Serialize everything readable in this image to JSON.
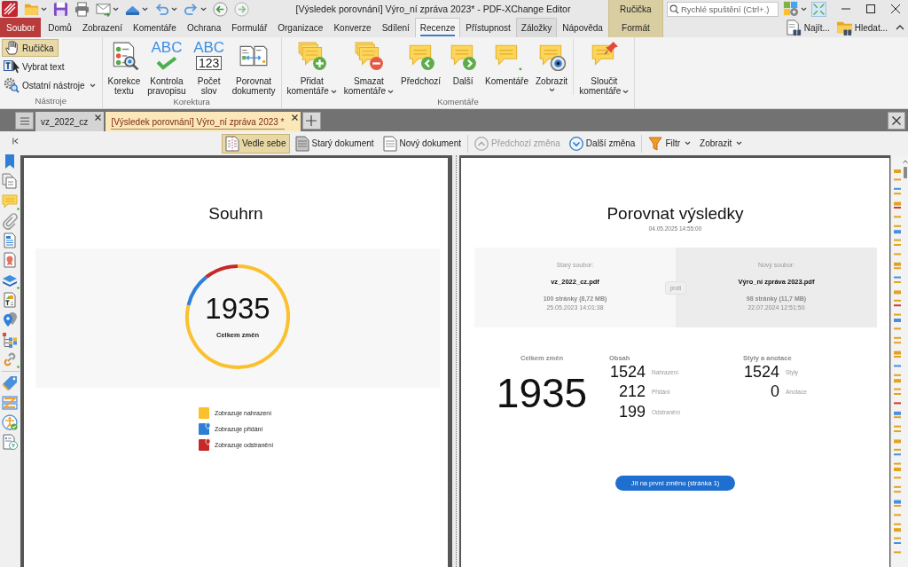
{
  "title_bar": {
    "title": "[Výsledek porovnání] Výro_ní zpráva 2023* - PDF-XChange Editor",
    "context_group": "Ručička",
    "search": {
      "placeholder": "Rychlé spuštění (Ctrl+.)"
    }
  },
  "menu_tabs": [
    {
      "label": "Soubor",
      "kind": "file",
      "selected": false,
      "hovered": false
    },
    {
      "label": "Domů",
      "kind": "tab",
      "selected": false,
      "hovered": false
    },
    {
      "label": "Zobrazení",
      "kind": "tab",
      "selected": false,
      "hovered": false
    },
    {
      "label": "Komentáře",
      "kind": "tab",
      "selected": false,
      "hovered": false
    },
    {
      "label": "Ochrana",
      "kind": "tab",
      "selected": false,
      "hovered": false
    },
    {
      "label": "Formulář",
      "kind": "tab",
      "selected": false,
      "hovered": false
    },
    {
      "label": "Organizace",
      "kind": "tab",
      "selected": false,
      "hovered": false
    },
    {
      "label": "Konverze",
      "kind": "tab",
      "selected": false,
      "hovered": false
    },
    {
      "label": "Sdílení",
      "kind": "tab",
      "selected": false,
      "hovered": false
    },
    {
      "label": "Recenze",
      "kind": "tab",
      "selected": true,
      "hovered": false
    },
    {
      "label": "Přístupnost",
      "kind": "tab",
      "selected": false,
      "hovered": false
    },
    {
      "label": "Záložky",
      "kind": "tab",
      "selected": false,
      "hovered": true
    },
    {
      "label": "Nápověda",
      "kind": "tab",
      "selected": false,
      "hovered": false
    }
  ],
  "context_tab": {
    "label": "Formát"
  },
  "menu_tools": [
    {
      "label": "Najít..."
    },
    {
      "label": "Hledat..."
    }
  ],
  "ribbon": [
    {
      "label": "Nástroje",
      "kind": "tools",
      "sections": [
        [
          {
            "label": "Ručička",
            "selected": true,
            "dropdown": false
          },
          {
            "label": "Vybrat text",
            "selected": false,
            "dropdown": false
          },
          {
            "label": "Ostatní nástroje",
            "selected": false,
            "dropdown": true
          }
        ]
      ]
    },
    {
      "label": "Korektura",
      "kind": "large",
      "sections": [
        [
          {
            "lines": [
              "Korekce",
              "textu"
            ],
            "dropdown": false
          },
          {
            "icon_text": [
              "ABC"
            ],
            "lines": [
              "Kontrola",
              "pravopisu"
            ],
            "dropdown": false
          },
          {
            "icon_text": [
              "ABC",
              "123"
            ],
            "lines": [
              "Počet",
              "slov"
            ],
            "dropdown": false
          },
          {
            "lines": [
              "Porovnat",
              "dokumenty"
            ],
            "dropdown": false
          }
        ]
      ]
    },
    {
      "label": "Komentáře",
      "kind": "large",
      "sections": [
        [
          {
            "lines": [
              "Přidat",
              "komentáře"
            ],
            "dropdown": true
          },
          {
            "lines": [
              "Smazat",
              "komentáře"
            ],
            "dropdown": true
          },
          {
            "lines": [
              "Předchozí"
            ],
            "dropdown": false
          },
          {
            "lines": [
              "Další"
            ],
            "dropdown": false
          },
          {
            "lines": [
              "Komentáře"
            ],
            "dropdown": false
          },
          {
            "lines": [
              "Zobrazit"
            ],
            "dropdown": true
          }
        ],
        [
          {
            "lines": [
              "Sloučit",
              "komentáře"
            ],
            "dropdown": true
          }
        ]
      ]
    }
  ],
  "doc_tabs": [
    {
      "label": "vz_2022_cz",
      "selected": false
    },
    {
      "label": "[Výsledek porovnání] Výro_ní zpráva 2023 *",
      "selected": true
    }
  ],
  "compare_toolbar": [
    [
      {
        "label": "Vedle sebe",
        "selected": true,
        "disabled": false,
        "dropdown": false
      },
      {
        "label": "Starý dokument",
        "selected": false,
        "disabled": false,
        "dropdown": false
      },
      {
        "label": "Nový dokument",
        "selected": false,
        "disabled": false,
        "dropdown": false
      }
    ],
    [
      {
        "label": "Předchozí změna",
        "selected": false,
        "disabled": true,
        "dropdown": false
      },
      {
        "label": "Další změna",
        "selected": false,
        "disabled": false,
        "dropdown": false
      }
    ],
    [
      {
        "label": "Filtr",
        "selected": false,
        "disabled": false,
        "dropdown": true
      },
      {
        "label": "Zobrazit",
        "selected": false,
        "disabled": false,
        "dropdown": true
      }
    ]
  ],
  "side_panel": [
    [
      {
        "dot": false
      },
      {
        "dot": false
      },
      {
        "dot": true
      },
      {
        "dot": false
      },
      {
        "dot": false
      },
      {
        "dot": false
      },
      {
        "dot": true
      },
      {
        "dot": false
      },
      {
        "dot": false
      },
      {
        "dot": false
      },
      {
        "dot": true
      }
    ],
    [
      {
        "dot": false
      },
      {
        "dot": false
      },
      {
        "dot": false
      },
      {
        "dot": false
      }
    ]
  ],
  "summary_page": {
    "title": "Souhrn",
    "total": "1935",
    "total_label": "Celkem změn",
    "legend": [
      {
        "label": "Zobrazuje nahrazení",
        "kind": "box",
        "color": "#fbc02d"
      },
      {
        "label": "Zobrazuje přidání",
        "kind": "pin",
        "color": "#2f7ed8"
      },
      {
        "label": "Zobrazuje odstranění",
        "kind": "pin",
        "color": "#c62828"
      }
    ]
  },
  "results_page": {
    "title": "Porovnat výsledky",
    "date": "04.05.2025 14:55:00",
    "files": [
      {
        "heading": "Starý soubor:",
        "name": "vz_2022_cz.pdf",
        "info": "100 stránky (8,72 MB)",
        "date": "25.05.2023 14:01:38"
      },
      {
        "heading": "Nový soubor:",
        "name": "Výro_ní zpráva 2023.pdf",
        "info": "98 stránky (11,7 MB)",
        "date": "22.07.2024 12:51:50"
      }
    ],
    "versus": "proti",
    "stats": [
      {
        "kind": "total",
        "label": "Celkem změn",
        "value": "1935"
      },
      {
        "kind": "list",
        "label": "Obsah",
        "rows": [
          {
            "value": "1524",
            "label": "Nahrazení"
          },
          {
            "value": "212",
            "label": "Přidání"
          },
          {
            "value": "199",
            "label": "Odstranění"
          }
        ]
      },
      {
        "kind": "list",
        "label": "Styly a anotace",
        "rows": [
          {
            "value": "1524",
            "label": "Styly"
          },
          {
            "value": "0",
            "label": "Anotace"
          }
        ]
      }
    ],
    "button": "Jít na první změnu (stránka 1)"
  }
}
